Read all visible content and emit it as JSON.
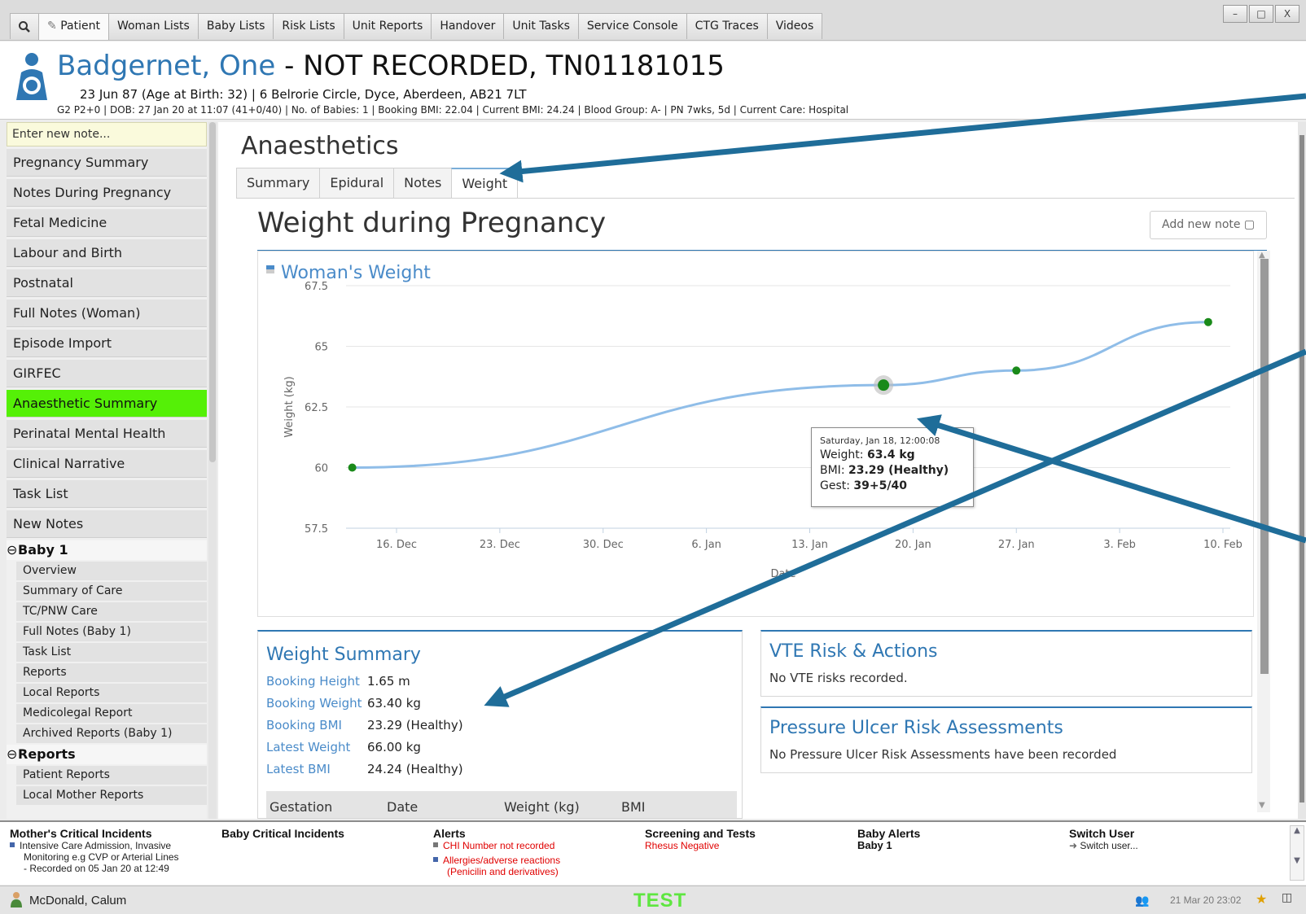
{
  "top_tabs": [
    {
      "label": "Patient",
      "icon": "patient-icon"
    },
    {
      "label": "Woman Lists"
    },
    {
      "label": "Baby Lists"
    },
    {
      "label": "Risk Lists"
    },
    {
      "label": "Unit Reports"
    },
    {
      "label": "Handover"
    },
    {
      "label": "Unit Tasks"
    },
    {
      "label": "Service Console"
    },
    {
      "label": "CTG Traces"
    },
    {
      "label": "Videos"
    }
  ],
  "window_controls": {
    "minimize": "–",
    "maximize": "□",
    "close": "X"
  },
  "patient": {
    "name": "Badgernet, One",
    "name_rest": " - NOT RECORDED, TN01181015",
    "line1": "23 Jun 87 (Age at Birth: 32) | 6 Belrorie Circle, Dyce, Aberdeen, AB21 7LT",
    "line2": "G2 P2+0 | DOB: 27 Jan 20 at 11:07 (41+0/40) | No. of Babies: 1 | Booking BMI: 22.04 | Current BMI: 24.24 | Blood Group: A- | PN 7wks, 5d | Current Care: Hospital"
  },
  "nav": {
    "new_note_placeholder": "Enter new note...",
    "items": [
      {
        "label": "Pregnancy Summary"
      },
      {
        "label": "Notes During Pregnancy"
      },
      {
        "label": "Fetal Medicine"
      },
      {
        "label": "Labour and Birth"
      },
      {
        "label": "Postnatal"
      },
      {
        "label": "Full Notes (Woman)"
      },
      {
        "label": "Episode Import"
      },
      {
        "label": "GIRFEC"
      },
      {
        "label": "Anaesthetic Summary"
      },
      {
        "label": "Perinatal Mental Health"
      },
      {
        "label": "Clinical Narrative"
      },
      {
        "label": "Task List"
      },
      {
        "label": "New Notes"
      }
    ],
    "baby_group": {
      "toggle": "⊖",
      "label": "Baby 1"
    },
    "baby_items": [
      {
        "label": "Overview"
      },
      {
        "label": "Summary of Care"
      },
      {
        "label": "TC/PNW Care"
      },
      {
        "label": "Full Notes (Baby 1)"
      },
      {
        "label": "Task List"
      },
      {
        "label": "Reports"
      },
      {
        "label": "Local Reports"
      },
      {
        "label": "Medicolegal Report"
      },
      {
        "label": "Archived Reports (Baby 1)"
      }
    ],
    "reports_group": {
      "toggle": "⊖",
      "label": "Reports"
    },
    "report_items": [
      {
        "label": "Patient Reports"
      },
      {
        "label": "Local Mother Reports"
      }
    ]
  },
  "main": {
    "section_title": "Anaesthetics",
    "tabs": [
      {
        "label": "Summary"
      },
      {
        "label": "Epidural"
      },
      {
        "label": "Notes"
      },
      {
        "label": "Weight"
      }
    ],
    "page_title": "Weight during Pregnancy",
    "add_note_label": "Add new note ▢"
  },
  "chart_data": {
    "type": "line",
    "title": "Woman's Weight",
    "xlabel": "Date",
    "ylabel": "Weight (kg)",
    "ylim": [
      57.5,
      67.5
    ],
    "yticks": [
      "57.5",
      "60",
      "62.5",
      "65",
      "67.5"
    ],
    "xticks": [
      "16. Dec",
      "23. Dec",
      "30. Dec",
      "6. Jan",
      "13. Jan",
      "20. Jan",
      "27. Jan",
      "3. Feb",
      "10. Feb"
    ],
    "series": [
      {
        "x": [
          "2019-12-13",
          "2020-01-18",
          "2020-01-27",
          "2020-02-09"
        ],
        "y": [
          60.0,
          63.4,
          64.0,
          66.0
        ]
      }
    ],
    "grid": true,
    "line_color": "#8fbde8",
    "point_color": "#1a8a1a",
    "tooltip": {
      "date": "Saturday, Jan 18, 12:00:08",
      "weight_label": "Weight:",
      "weight_value": "63.4 kg",
      "bmi_label": "BMI:",
      "bmi_value": "23.29 (Healthy)",
      "gest_label": "Gest:",
      "gest_value": "39+5/40"
    }
  },
  "weight_summary": {
    "title": "Weight Summary",
    "rows": [
      {
        "label": "Booking Height",
        "value": "1.65 m"
      },
      {
        "label": "Booking Weight",
        "value": "63.40 kg"
      },
      {
        "label": "Booking BMI",
        "value": "23.29 (Healthy)"
      },
      {
        "label": "Latest Weight",
        "value": "66.00 kg"
      },
      {
        "label": "Latest BMI",
        "value": "24.24 (Healthy)"
      }
    ],
    "columns": [
      "Gestation",
      "Date",
      "Weight (kg)",
      "BMI"
    ]
  },
  "vte": {
    "title": "VTE Risk & Actions",
    "text": "No VTE risks recorded."
  },
  "pressure_ulcer": {
    "title": "Pressure Ulcer Risk Assessments",
    "text": "No Pressure Ulcer Risk Assessments have been recorded"
  },
  "bottom": {
    "mother_incidents": {
      "title": "Mother's Critical Incidents",
      "lines": [
        "Intensive Care Admission, Invasive",
        "Monitoring e.g CVP or Arterial Lines",
        "- Recorded on 05 Jan 20 at 12:49"
      ]
    },
    "baby_incidents": {
      "title": "Baby Critical Incidents"
    },
    "alerts": {
      "title": "Alerts",
      "items": [
        "CHI Number not recorded",
        "Allergies/adverse reactions",
        "(Penicilin and derivatives)"
      ]
    },
    "screening": {
      "title": "Screening and Tests",
      "items": [
        "Rhesus Negative"
      ]
    },
    "baby_alerts": {
      "title": "Baby Alerts",
      "items": [
        "Baby 1"
      ]
    },
    "switch_user": {
      "title": "Switch User",
      "items": [
        "Switch user..."
      ]
    }
  },
  "status": {
    "user": "McDonald, Calum",
    "env": "TEST",
    "datetime": "21 Mar 20 23:02"
  },
  "colors": {
    "accent": "#2f77b3",
    "active_nav": "#55f007",
    "alert_red": "#e00000",
    "arrow": "#1f6d99"
  }
}
